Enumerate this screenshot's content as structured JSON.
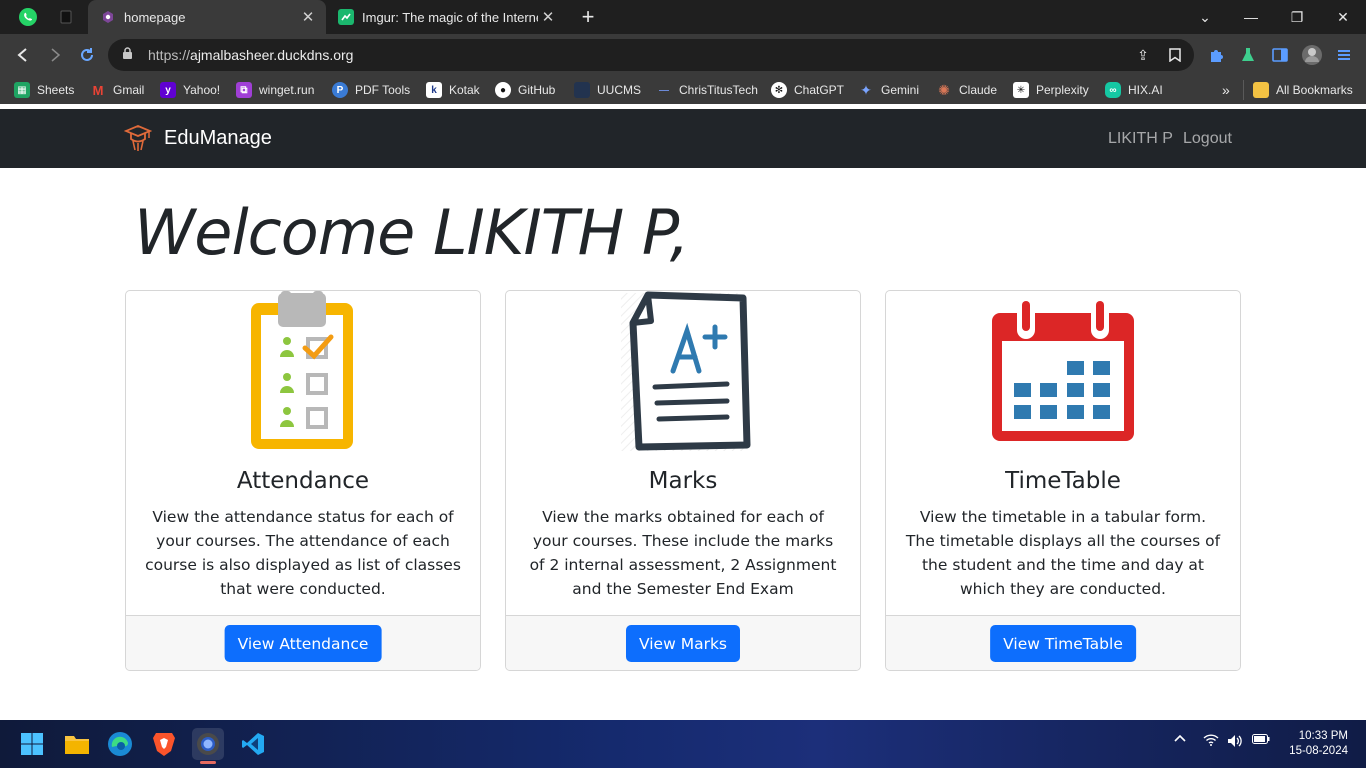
{
  "browser": {
    "tabs": [
      {
        "title": "homepage",
        "active": true
      },
      {
        "title": "Imgur: The magic of the Internet",
        "active": false
      }
    ],
    "url_scheme": "https://",
    "url_host": "ajmalbasheer.duckdns.org",
    "bookmarks": [
      "Sheets",
      "Gmail",
      "Yahoo!",
      "winget.run",
      "PDF Tools",
      "Kotak",
      "GitHub",
      "UUCMS",
      "ChrisTitusTech",
      "ChatGPT",
      "Gemini",
      "Claude",
      "Perplexity",
      "HIX.AI"
    ],
    "more_bookmarks": "»",
    "all_bookmarks": "All Bookmarks"
  },
  "site": {
    "brand": "EduManage",
    "user": "LIKITH P",
    "logout": "Logout",
    "welcome_prefix": "Welcome ",
    "welcome_name": "LIKITH P,"
  },
  "cards": [
    {
      "title": "Attendance",
      "text": "View the attendance status for each of your courses. The attendance of each course is also displayed as list of classes that were conducted.",
      "button": "View Attendance"
    },
    {
      "title": "Marks",
      "text": "View the marks obtained for each of your courses. These include the marks of 2 internal assessment, 2 Assignment and the Semester End Exam",
      "button": "View Marks"
    },
    {
      "title": "TimeTable",
      "text": "View the timetable in a tabular form. The timetable displays all the courses of the student and the time and day at which they are conducted.",
      "button": "View TimeTable"
    }
  ],
  "taskbar": {
    "time": "10:33 PM",
    "date": "15-08-2024"
  },
  "colors": {
    "navbar": "#212529",
    "primary": "#0d6efd",
    "attendance_yellow": "#f7b500",
    "timetable_red": "#dc2626",
    "timetable_blue": "#2f7ab0"
  }
}
